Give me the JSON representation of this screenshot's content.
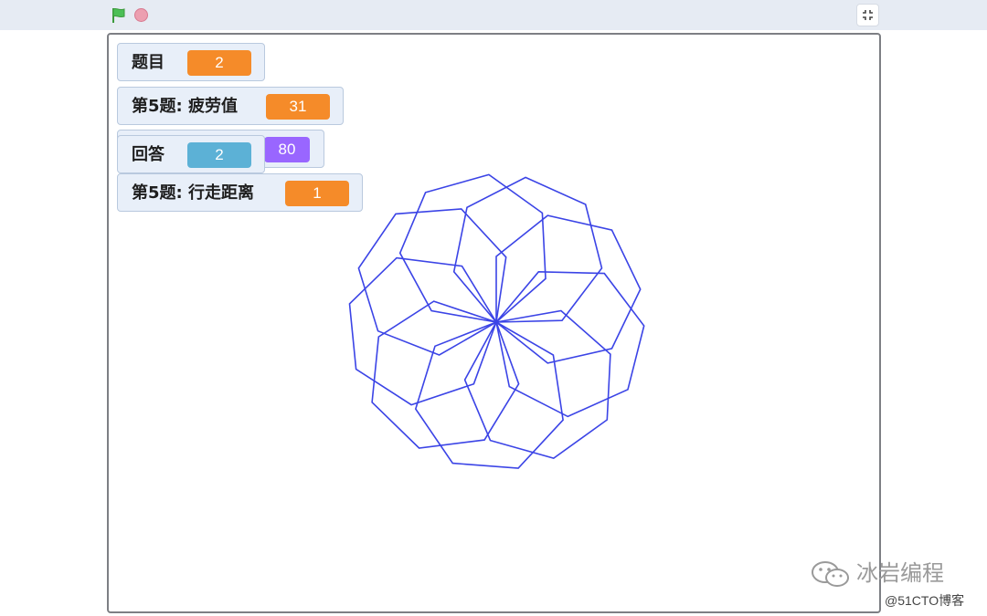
{
  "toolbar": {
    "green_flag_icon": "green-flag-icon",
    "stop_icon": "stop-sign-icon",
    "fullscreen_icon": "unfullscreen-icon"
  },
  "monitors": [
    {
      "label": "题目",
      "value": "2",
      "color": "#f58b29"
    },
    {
      "label": "第5题: 疲劳值",
      "value": "31",
      "color": "#f58b29"
    },
    {
      "label": "",
      "value": "80",
      "color": "#9966ff"
    },
    {
      "label": "回答",
      "value": "2",
      "color": "#5cb1d6"
    },
    {
      "label": "第5题: 行走距离",
      "value": "1",
      "color": "#f58b29"
    }
  ],
  "pen_drawing": {
    "shape": "rotated heptagons",
    "count": 9,
    "pen_color": "#3b44e6"
  },
  "watermark": {
    "brand": "冰岩编程",
    "source": "@51CTO博客"
  }
}
